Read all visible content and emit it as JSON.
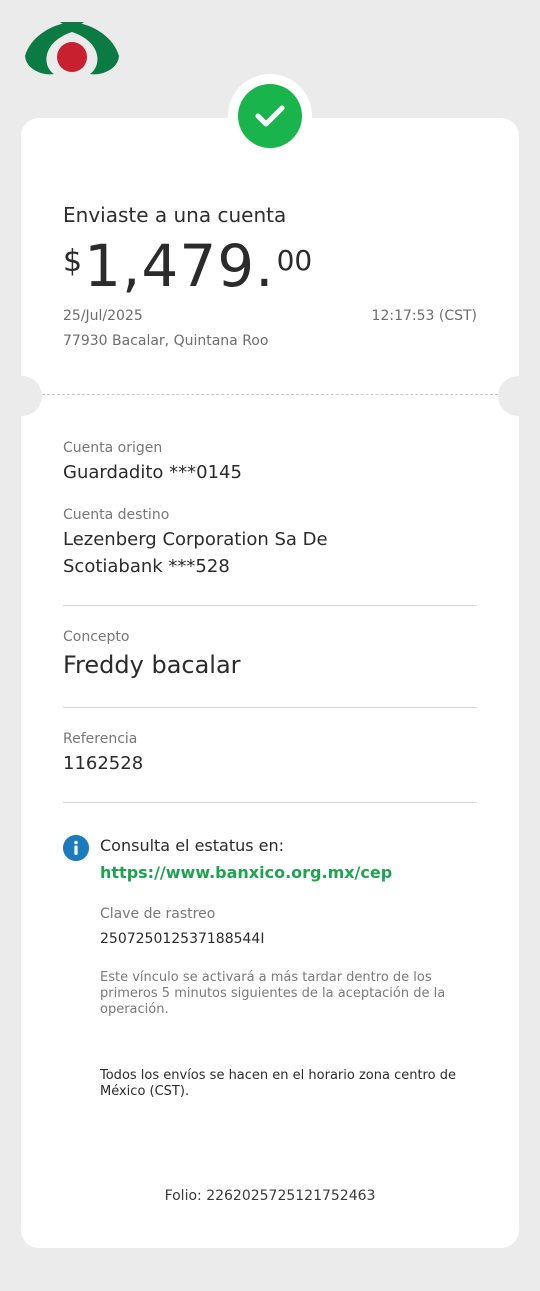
{
  "receipt": {
    "title": "Enviaste a una cuenta",
    "amount": {
      "currency": "$",
      "integer": "1,479.",
      "decimals": "00"
    },
    "date": "25/Jul/2025",
    "time": "12:17:53 (CST)",
    "location": "77930 Bacalar, Quintana Roo"
  },
  "details": {
    "origin_label": "Cuenta origen",
    "origin_value": "Guardadito ***0145",
    "dest_label": "Cuenta destino",
    "dest_line1": "Lezenberg Corporation Sa De",
    "dest_line2": "Scotiabank ***528",
    "concept_label": "Concepto",
    "concept_value": "Freddy bacalar",
    "reference_label": "Referencia",
    "reference_value": "1162528"
  },
  "status": {
    "consult_text": "Consulta el estatus en:",
    "link": "https://www.banxico.org.mx/cep",
    "tracking_label": "Clave de rastreo",
    "tracking_value": "25072501253718854​4I",
    "note": "Este vínculo se activará a más tardar dentro de los primeros 5 minutos siguientes de la aceptación de la operación.",
    "schedule_note": "Todos los envíos se hacen en el horario zona centro de México (CST)."
  },
  "footer": {
    "folio": "Folio: 2262025725121752463"
  },
  "colors": {
    "brand_green": "#0c7a43",
    "brand_red": "#c8202f",
    "success": "#19b54c",
    "link": "#1fa351",
    "info": "#1b7bbf"
  },
  "icons": {
    "logo": "bank-logo-icon",
    "success": "checkmark-icon",
    "info": "info-icon"
  }
}
